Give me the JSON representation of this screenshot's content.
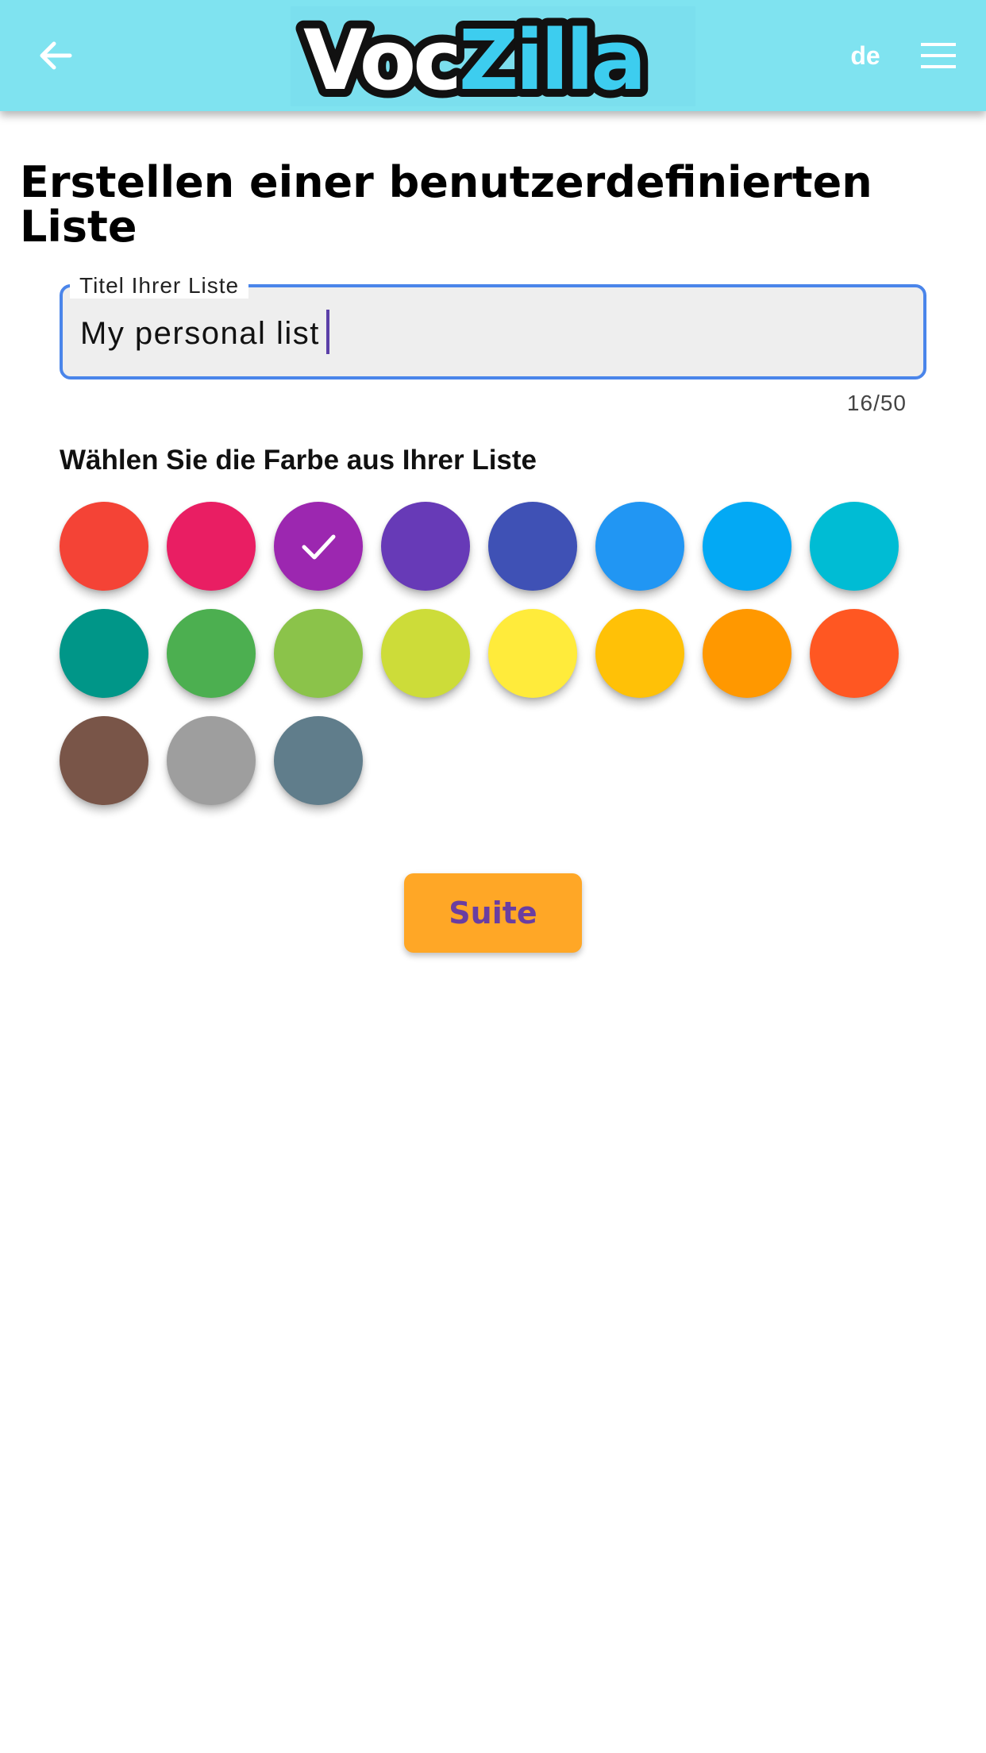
{
  "header": {
    "logo_part1": "Voc",
    "logo_part2": "Zilla",
    "language": "de",
    "back_icon": "arrow-left-icon",
    "menu_icon": "hamburger-menu-icon",
    "bar_color": "#7fe3f0"
  },
  "page": {
    "title": "Erstellen einer benutzerdefinierten Liste"
  },
  "title_field": {
    "label": "Titel Ihrer Liste",
    "value": "My personal list",
    "counter": "16/50"
  },
  "color_section": {
    "label": "Wählen Sie die Farbe aus Ihrer Liste",
    "selected_index": 2,
    "selected_icon": "check-icon",
    "colors": [
      "#f44336",
      "#e91e63",
      "#9c27b0",
      "#673ab7",
      "#3f51b5",
      "#2196f3",
      "#03a9f4",
      "#00bcd4",
      "#009688",
      "#4caf50",
      "#8bc34a",
      "#cddc39",
      "#ffeb3b",
      "#ffc107",
      "#ff9800",
      "#ff5722",
      "#795548",
      "#9e9e9e",
      "#607d8b"
    ]
  },
  "actions": {
    "next_label": "Suite"
  }
}
